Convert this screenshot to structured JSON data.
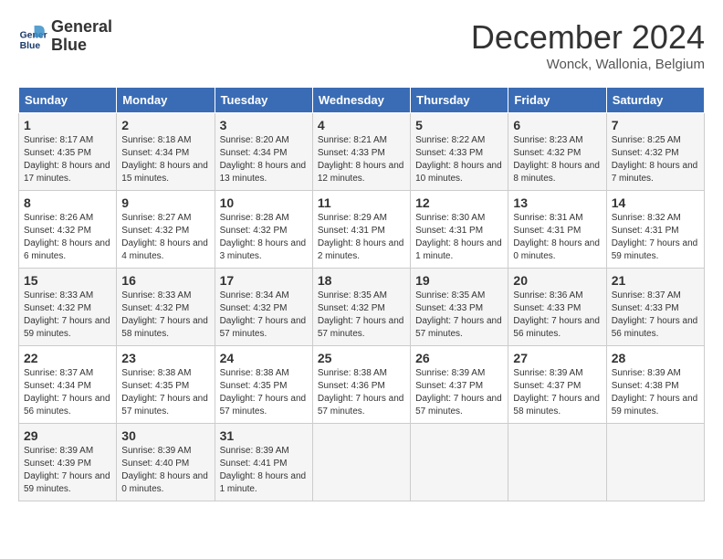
{
  "header": {
    "logo_line1": "General",
    "logo_line2": "Blue",
    "month": "December 2024",
    "location": "Wonck, Wallonia, Belgium"
  },
  "days_of_week": [
    "Sunday",
    "Monday",
    "Tuesday",
    "Wednesday",
    "Thursday",
    "Friday",
    "Saturday"
  ],
  "weeks": [
    [
      {
        "day": "1",
        "sunrise": "8:17 AM",
        "sunset": "4:35 PM",
        "daylight": "8 hours and 17 minutes."
      },
      {
        "day": "2",
        "sunrise": "8:18 AM",
        "sunset": "4:34 PM",
        "daylight": "8 hours and 15 minutes."
      },
      {
        "day": "3",
        "sunrise": "8:20 AM",
        "sunset": "4:34 PM",
        "daylight": "8 hours and 13 minutes."
      },
      {
        "day": "4",
        "sunrise": "8:21 AM",
        "sunset": "4:33 PM",
        "daylight": "8 hours and 12 minutes."
      },
      {
        "day": "5",
        "sunrise": "8:22 AM",
        "sunset": "4:33 PM",
        "daylight": "8 hours and 10 minutes."
      },
      {
        "day": "6",
        "sunrise": "8:23 AM",
        "sunset": "4:32 PM",
        "daylight": "8 hours and 8 minutes."
      },
      {
        "day": "7",
        "sunrise": "8:25 AM",
        "sunset": "4:32 PM",
        "daylight": "8 hours and 7 minutes."
      }
    ],
    [
      {
        "day": "8",
        "sunrise": "8:26 AM",
        "sunset": "4:32 PM",
        "daylight": "8 hours and 6 minutes."
      },
      {
        "day": "9",
        "sunrise": "8:27 AM",
        "sunset": "4:32 PM",
        "daylight": "8 hours and 4 minutes."
      },
      {
        "day": "10",
        "sunrise": "8:28 AM",
        "sunset": "4:32 PM",
        "daylight": "8 hours and 3 minutes."
      },
      {
        "day": "11",
        "sunrise": "8:29 AM",
        "sunset": "4:31 PM",
        "daylight": "8 hours and 2 minutes."
      },
      {
        "day": "12",
        "sunrise": "8:30 AM",
        "sunset": "4:31 PM",
        "daylight": "8 hours and 1 minute."
      },
      {
        "day": "13",
        "sunrise": "8:31 AM",
        "sunset": "4:31 PM",
        "daylight": "8 hours and 0 minutes."
      },
      {
        "day": "14",
        "sunrise": "8:32 AM",
        "sunset": "4:31 PM",
        "daylight": "7 hours and 59 minutes."
      }
    ],
    [
      {
        "day": "15",
        "sunrise": "8:33 AM",
        "sunset": "4:32 PM",
        "daylight": "7 hours and 59 minutes."
      },
      {
        "day": "16",
        "sunrise": "8:33 AM",
        "sunset": "4:32 PM",
        "daylight": "7 hours and 58 minutes."
      },
      {
        "day": "17",
        "sunrise": "8:34 AM",
        "sunset": "4:32 PM",
        "daylight": "7 hours and 57 minutes."
      },
      {
        "day": "18",
        "sunrise": "8:35 AM",
        "sunset": "4:32 PM",
        "daylight": "7 hours and 57 minutes."
      },
      {
        "day": "19",
        "sunrise": "8:35 AM",
        "sunset": "4:33 PM",
        "daylight": "7 hours and 57 minutes."
      },
      {
        "day": "20",
        "sunrise": "8:36 AM",
        "sunset": "4:33 PM",
        "daylight": "7 hours and 56 minutes."
      },
      {
        "day": "21",
        "sunrise": "8:37 AM",
        "sunset": "4:33 PM",
        "daylight": "7 hours and 56 minutes."
      }
    ],
    [
      {
        "day": "22",
        "sunrise": "8:37 AM",
        "sunset": "4:34 PM",
        "daylight": "7 hours and 56 minutes."
      },
      {
        "day": "23",
        "sunrise": "8:38 AM",
        "sunset": "4:35 PM",
        "daylight": "7 hours and 57 minutes."
      },
      {
        "day": "24",
        "sunrise": "8:38 AM",
        "sunset": "4:35 PM",
        "daylight": "7 hours and 57 minutes."
      },
      {
        "day": "25",
        "sunrise": "8:38 AM",
        "sunset": "4:36 PM",
        "daylight": "7 hours and 57 minutes."
      },
      {
        "day": "26",
        "sunrise": "8:39 AM",
        "sunset": "4:37 PM",
        "daylight": "7 hours and 57 minutes."
      },
      {
        "day": "27",
        "sunrise": "8:39 AM",
        "sunset": "4:37 PM",
        "daylight": "7 hours and 58 minutes."
      },
      {
        "day": "28",
        "sunrise": "8:39 AM",
        "sunset": "4:38 PM",
        "daylight": "7 hours and 59 minutes."
      }
    ],
    [
      {
        "day": "29",
        "sunrise": "8:39 AM",
        "sunset": "4:39 PM",
        "daylight": "7 hours and 59 minutes."
      },
      {
        "day": "30",
        "sunrise": "8:39 AM",
        "sunset": "4:40 PM",
        "daylight": "8 hours and 0 minutes."
      },
      {
        "day": "31",
        "sunrise": "8:39 AM",
        "sunset": "4:41 PM",
        "daylight": "8 hours and 1 minute."
      },
      null,
      null,
      null,
      null
    ]
  ],
  "labels": {
    "sunrise": "Sunrise:",
    "sunset": "Sunset:",
    "daylight": "Daylight:"
  }
}
